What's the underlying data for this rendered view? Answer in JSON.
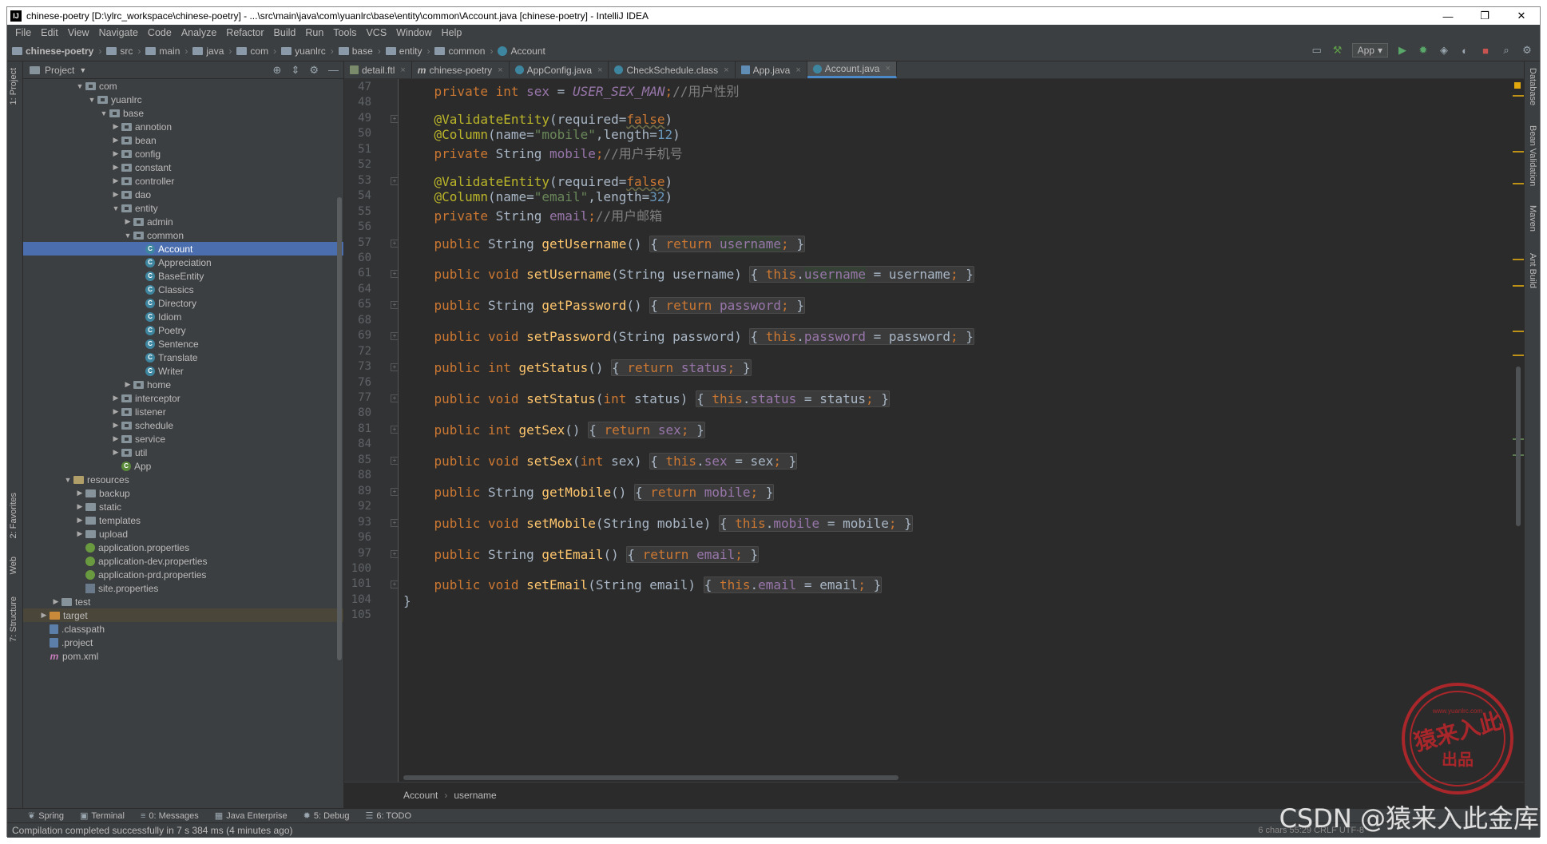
{
  "window": {
    "title": "chinese-poetry [D:\\ylrc_workspace\\chinese-poetry] - ...\\src\\main\\java\\com\\yuanlrc\\base\\entity\\common\\Account.java [chinese-poetry] - IntelliJ IDEA",
    "app_icon": "IJ",
    "controls": [
      "—",
      "❐",
      "✕"
    ]
  },
  "menu": [
    "File",
    "Edit",
    "View",
    "Navigate",
    "Code",
    "Analyze",
    "Refactor",
    "Build",
    "Run",
    "Tools",
    "VCS",
    "Window",
    "Help"
  ],
  "breadcrumb": [
    "chinese-poetry",
    "src",
    "main",
    "java",
    "com",
    "yuanlrc",
    "base",
    "entity",
    "common",
    "Account"
  ],
  "run_config": "App",
  "left_tabs": [
    "1: Project",
    "2: Favorites",
    "Web",
    "7: Structure"
  ],
  "right_tabs": [
    "Database",
    "Bean Validation",
    "Maven",
    "Ant Build"
  ],
  "project_panel": {
    "title": "Project",
    "tree": [
      {
        "label": "com",
        "depth": 4,
        "arrow": "▼",
        "icon": "pkg"
      },
      {
        "label": "yuanlrc",
        "depth": 5,
        "arrow": "▼",
        "icon": "pkg"
      },
      {
        "label": "base",
        "depth": 6,
        "arrow": "▼",
        "icon": "pkg"
      },
      {
        "label": "annotion",
        "depth": 7,
        "arrow": "▶",
        "icon": "pkg"
      },
      {
        "label": "bean",
        "depth": 7,
        "arrow": "▶",
        "icon": "pkg"
      },
      {
        "label": "config",
        "depth": 7,
        "arrow": "▶",
        "icon": "pkg"
      },
      {
        "label": "constant",
        "depth": 7,
        "arrow": "▶",
        "icon": "pkg"
      },
      {
        "label": "controller",
        "depth": 7,
        "arrow": "▶",
        "icon": "pkg"
      },
      {
        "label": "dao",
        "depth": 7,
        "arrow": "▶",
        "icon": "pkg"
      },
      {
        "label": "entity",
        "depth": 7,
        "arrow": "▼",
        "icon": "pkg"
      },
      {
        "label": "admin",
        "depth": 8,
        "arrow": "▶",
        "icon": "pkg"
      },
      {
        "label": "common",
        "depth": 8,
        "arrow": "▼",
        "icon": "pkg"
      },
      {
        "label": "Account",
        "depth": 9,
        "arrow": "",
        "icon": "class",
        "selected": true
      },
      {
        "label": "Appreciation",
        "depth": 9,
        "arrow": "",
        "icon": "class"
      },
      {
        "label": "BaseEntity",
        "depth": 9,
        "arrow": "",
        "icon": "class"
      },
      {
        "label": "Classics",
        "depth": 9,
        "arrow": "",
        "icon": "class"
      },
      {
        "label": "Directory",
        "depth": 9,
        "arrow": "",
        "icon": "class"
      },
      {
        "label": "Idiom",
        "depth": 9,
        "arrow": "",
        "icon": "class"
      },
      {
        "label": "Poetry",
        "depth": 9,
        "arrow": "",
        "icon": "class"
      },
      {
        "label": "Sentence",
        "depth": 9,
        "arrow": "",
        "icon": "class"
      },
      {
        "label": "Translate",
        "depth": 9,
        "arrow": "",
        "icon": "class"
      },
      {
        "label": "Writer",
        "depth": 9,
        "arrow": "",
        "icon": "class"
      },
      {
        "label": "home",
        "depth": 8,
        "arrow": "▶",
        "icon": "pkg"
      },
      {
        "label": "interceptor",
        "depth": 7,
        "arrow": "▶",
        "icon": "pkg"
      },
      {
        "label": "listener",
        "depth": 7,
        "arrow": "▶",
        "icon": "pkg"
      },
      {
        "label": "schedule",
        "depth": 7,
        "arrow": "▶",
        "icon": "pkg"
      },
      {
        "label": "service",
        "depth": 7,
        "arrow": "▶",
        "icon": "pkg"
      },
      {
        "label": "util",
        "depth": 7,
        "arrow": "▶",
        "icon": "pkg"
      },
      {
        "label": "App",
        "depth": 7,
        "arrow": "",
        "icon": "spring-class"
      },
      {
        "label": "resources",
        "depth": 3,
        "arrow": "▼",
        "icon": "res"
      },
      {
        "label": "backup",
        "depth": 4,
        "arrow": "▶",
        "icon": "folder"
      },
      {
        "label": "static",
        "depth": 4,
        "arrow": "▶",
        "icon": "folder"
      },
      {
        "label": "templates",
        "depth": 4,
        "arrow": "▶",
        "icon": "folder"
      },
      {
        "label": "upload",
        "depth": 4,
        "arrow": "▶",
        "icon": "folder"
      },
      {
        "label": "application.properties",
        "depth": 4,
        "arrow": "",
        "icon": "spring"
      },
      {
        "label": "application-dev.properties",
        "depth": 4,
        "arrow": "",
        "icon": "spring"
      },
      {
        "label": "application-prd.properties",
        "depth": 4,
        "arrow": "",
        "icon": "spring"
      },
      {
        "label": "site.properties",
        "depth": 4,
        "arrow": "",
        "icon": "props"
      },
      {
        "label": "test",
        "depth": 2,
        "arrow": "▶",
        "icon": "folder"
      },
      {
        "label": "target",
        "depth": 1,
        "arrow": "▶",
        "icon": "orange",
        "excluded": true
      },
      {
        "label": ".classpath",
        "depth": 1,
        "arrow": "",
        "icon": "file"
      },
      {
        "label": ".project",
        "depth": 1,
        "arrow": "",
        "icon": "file"
      },
      {
        "label": "pom.xml",
        "depth": 1,
        "arrow": "",
        "icon": "m"
      }
    ]
  },
  "editor_tabs": [
    {
      "label": "detail.ftl",
      "icon": "ftl"
    },
    {
      "label": "chinese-poetry",
      "icon": "m"
    },
    {
      "label": "AppConfig.java",
      "icon": "class"
    },
    {
      "label": "CheckSchedule.class",
      "icon": "class"
    },
    {
      "label": "App.java",
      "icon": "app"
    },
    {
      "label": "Account.java",
      "icon": "class",
      "active": true
    }
  ],
  "code_lines": [
    {
      "n": "47",
      "html": "    <span class=\"kw\">private int </span><span class=\"fd\">sex</span> = <span class=\"fdi\">USER_SEX_MAN</span><span class=\"kw\">;</span><span class=\"cm\">//用户性别</span>"
    },
    {
      "n": "48",
      "html": ""
    },
    {
      "n": "49",
      "html": "    <span class=\"an\">@ValidateEntity</span>(required=<span class=\"kw wavy\">false</span>)"
    },
    {
      "n": "50",
      "html": "    <span class=\"an\">@Column</span>(name=<span class=\"st\">\"mobile\"</span>,length=<span class=\"nm\">12</span>)"
    },
    {
      "n": "51",
      "html": "    <span class=\"kw\">private </span>String <span class=\"fd\">mobile</span><span class=\"kw\">;</span><span class=\"cm\">//用户手机号</span>"
    },
    {
      "n": "52",
      "html": ""
    },
    {
      "n": "53",
      "html": "    <span class=\"an\">@ValidateEntity</span>(required=<span class=\"kw wavy\">false</span>)"
    },
    {
      "n": "54",
      "html": "    <span class=\"an\">@Column</span>(name=<span class=\"st\">\"email\"</span>,length=<span class=\"nm\">32</span>)"
    },
    {
      "n": "55",
      "html": "    <span class=\"kw\">private </span>String <span class=\"fd\">email</span><span class=\"kw\">;</span><span class=\"cm\">//用户邮箱</span>"
    },
    {
      "n": "56",
      "html": ""
    },
    {
      "n": "57",
      "html": "    <span class=\"kw\">public </span>String <span class=\"mt\">getUsername</span>() <span class=\"fbox\">{ <span class=\"kw\">return </span><span class=\"fd hl\">username</span><span class=\"kw\">;</span> }</span>"
    },
    {
      "n": "60",
      "html": ""
    },
    {
      "n": "61",
      "html": "    <span class=\"kw\">public void </span><span class=\"mt\">setUsername</span>(String username) <span class=\"fbox\">{ <span class=\"kw\">this</span>.<span class=\"fd hl\">username</span> = username<span class=\"kw\">;</span> }</span>"
    },
    {
      "n": "64",
      "html": ""
    },
    {
      "n": "65",
      "html": "    <span class=\"kw\">public </span>String <span class=\"mt\">getPassword</span>() <span class=\"fbox\">{ <span class=\"kw\">return </span><span class=\"fd\">password</span><span class=\"kw\">;</span> }</span>"
    },
    {
      "n": "68",
      "html": ""
    },
    {
      "n": "69",
      "html": "    <span class=\"kw\">public void </span><span class=\"mt\">setPassword</span>(String password) <span class=\"fbox\">{ <span class=\"kw\">this</span>.<span class=\"fd\">password</span> = password<span class=\"kw\">;</span> }</span>"
    },
    {
      "n": "72",
      "html": ""
    },
    {
      "n": "73",
      "html": "    <span class=\"kw\">public int </span><span class=\"mt\">getStatus</span>() <span class=\"fbox\">{ <span class=\"kw\">return </span><span class=\"fd\">status</span><span class=\"kw\">;</span> }</span>"
    },
    {
      "n": "76",
      "html": ""
    },
    {
      "n": "77",
      "html": "    <span class=\"kw\">public void </span><span class=\"mt\">setStatus</span>(<span class=\"kw\">int </span>status) <span class=\"fbox\">{ <span class=\"kw\">this</span>.<span class=\"fd\">status</span> = status<span class=\"kw\">;</span> }</span>"
    },
    {
      "n": "80",
      "html": ""
    },
    {
      "n": "81",
      "html": "    <span class=\"kw\">public int </span><span class=\"mt\">getSex</span>() <span class=\"fbox\">{ <span class=\"kw\">return </span><span class=\"fd\">sex</span><span class=\"kw\">;</span> }</span>"
    },
    {
      "n": "84",
      "html": ""
    },
    {
      "n": "85",
      "html": "    <span class=\"kw\">public void </span><span class=\"mt\">setSex</span>(<span class=\"kw\">int </span>sex) <span class=\"fbox\">{ <span class=\"kw\">this</span>.<span class=\"fd\">sex</span> = sex<span class=\"kw\">;</span> }</span>"
    },
    {
      "n": "88",
      "html": ""
    },
    {
      "n": "89",
      "html": "    <span class=\"kw\">public </span>String <span class=\"mt\">getMobile</span>() <span class=\"fbox\">{ <span class=\"kw\">return </span><span class=\"fd\">mobile</span><span class=\"kw\">;</span> }</span>"
    },
    {
      "n": "92",
      "html": ""
    },
    {
      "n": "93",
      "html": "    <span class=\"kw\">public void </span><span class=\"mt\">setMobile</span>(String mobile) <span class=\"fbox\">{ <span class=\"kw\">this</span>.<span class=\"fd\">mobile</span> = mobile<span class=\"kw\">;</span> }</span>"
    },
    {
      "n": "96",
      "html": ""
    },
    {
      "n": "97",
      "html": "    <span class=\"kw\">public </span>String <span class=\"mt\">getEmail</span>() <span class=\"fbox\">{ <span class=\"kw\">return </span><span class=\"fd\">email</span><span class=\"kw\">;</span> }</span>"
    },
    {
      "n": "100",
      "html": ""
    },
    {
      "n": "101",
      "html": "    <span class=\"kw\">public void </span><span class=\"mt\">setEmail</span>(String email) <span class=\"fbox\">{ <span class=\"kw\">this</span>.<span class=\"fd\">email</span> = email<span class=\"kw\">;</span> }</span>"
    },
    {
      "n": "104",
      "html": "}"
    },
    {
      "n": "105",
      "html": ""
    }
  ],
  "editor_breadcrumb": [
    "Account",
    "username"
  ],
  "bottom_tools": [
    {
      "label": "Spring",
      "icon": "spring-icon"
    },
    {
      "label": "Terminal",
      "icon": "terminal-icon"
    },
    {
      "label": "0: Messages",
      "icon": "messages-icon"
    },
    {
      "label": "Java Enterprise",
      "icon": "java-enterprise-icon"
    },
    {
      "label": "5: Debug",
      "icon": "debug-icon"
    },
    {
      "label": "6: TODO",
      "icon": "todo-icon"
    }
  ],
  "status": {
    "message": "Compilation completed successfully in 7 s 384 ms (4 minutes ago)",
    "right": "6 chars    55:29    CRLF    UTF-8"
  },
  "watermark": "CSDN @猿来入此金库",
  "stamp": {
    "url": "www.yuanlrc.com",
    "line1": "猿来入此",
    "line2": "出品"
  }
}
